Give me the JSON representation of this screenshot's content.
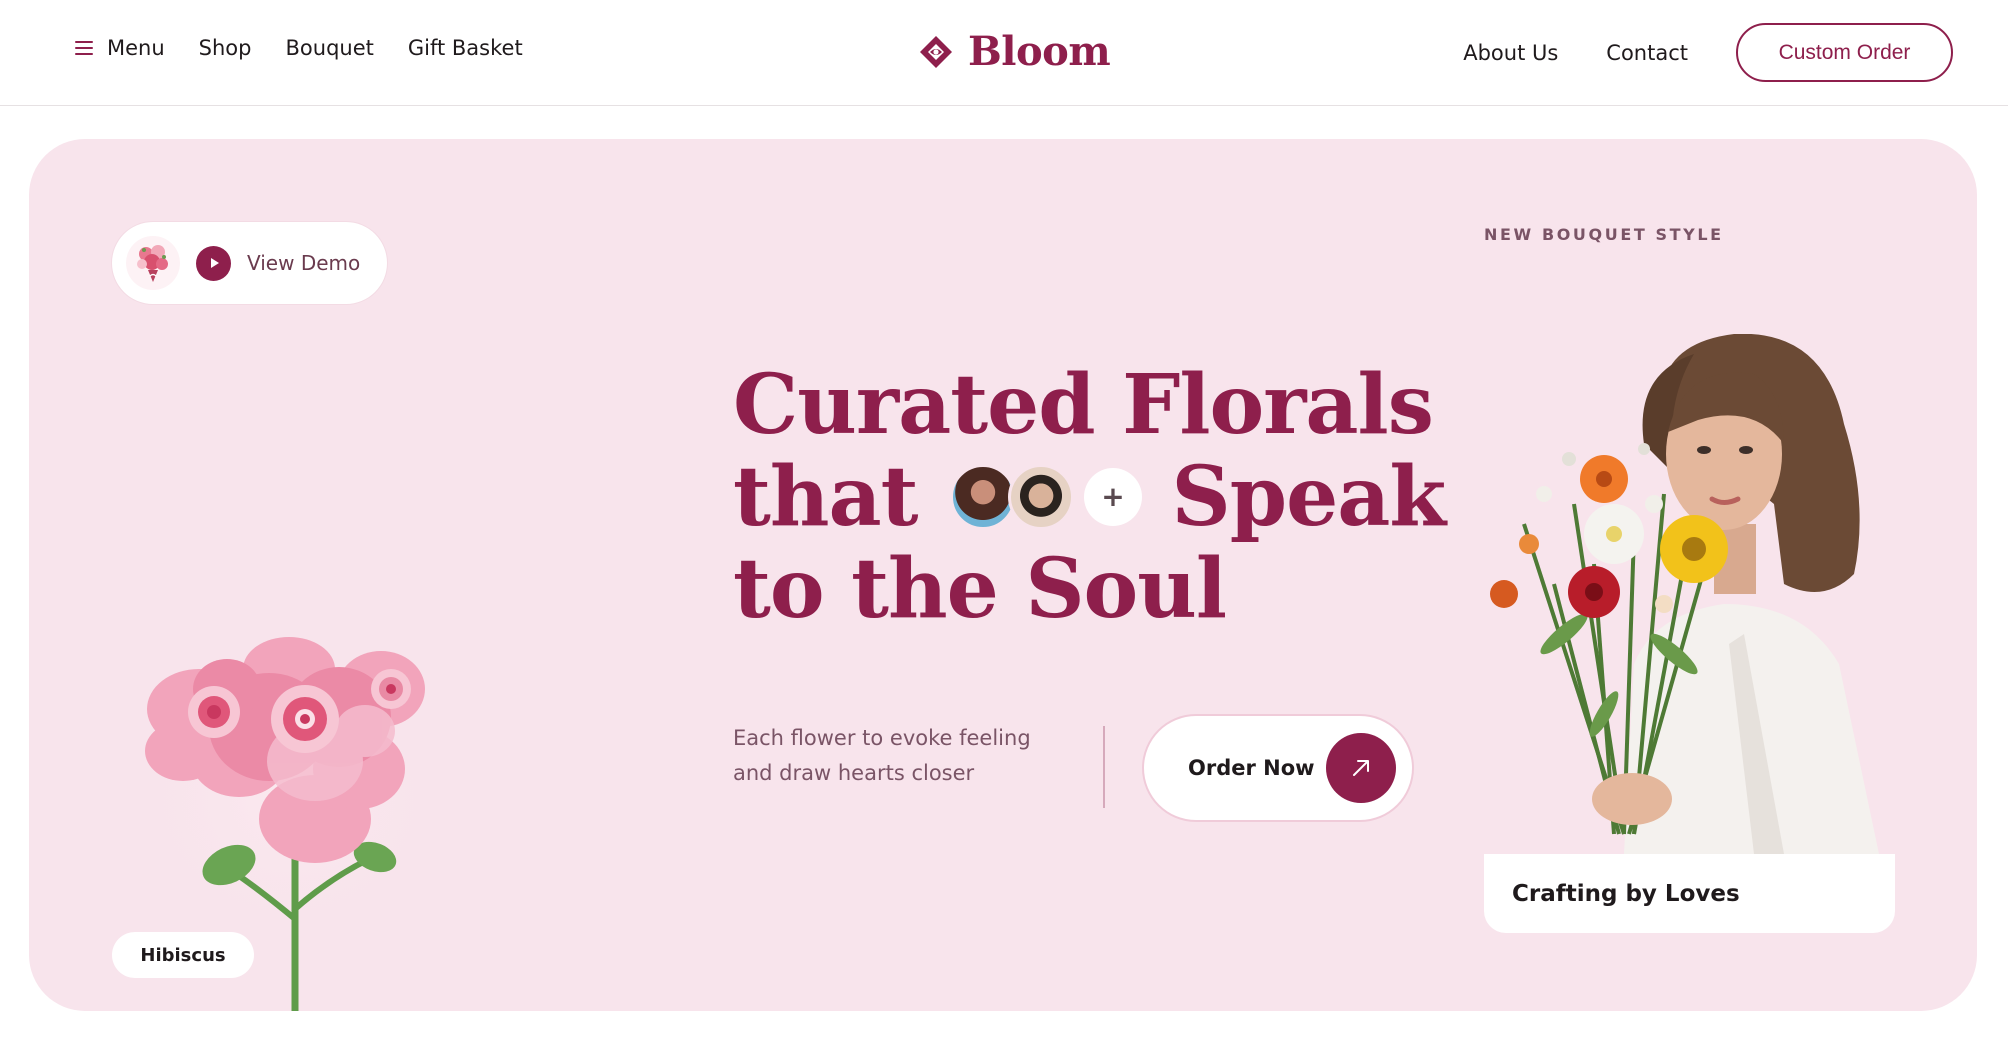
{
  "header": {
    "menu_label": "Menu",
    "nav_left": [
      "Shop",
      "Bouquet",
      "Gift Basket"
    ],
    "brand": "Bloom",
    "nav_right": [
      "About Us",
      "Contact"
    ],
    "cta_label": "Custom Order"
  },
  "hero": {
    "demo_label": "View Demo",
    "headline": {
      "line1": "Curated Florals",
      "line2_a": "that",
      "line2_b": "Speak",
      "line3": "to the Soul"
    },
    "plus_symbol": "+",
    "subtext_line1": "Each flower to evoke feeling",
    "subtext_line2": "and draw hearts closer",
    "order_label": "Order Now",
    "eyebrow": "NEW BOUQUET STYLE",
    "caption": "Crafting by Loves",
    "flower_tag": "Hibiscus"
  },
  "colors": {
    "brand": "#8e1f4c",
    "hero_bg": "#f8e4ec",
    "text_muted": "#7a5466"
  },
  "icons": [
    "hamburger-icon",
    "logo-diamond-icon",
    "play-icon",
    "plus-icon",
    "arrow-up-right-icon",
    "bouquet-thumbnail-icon"
  ]
}
